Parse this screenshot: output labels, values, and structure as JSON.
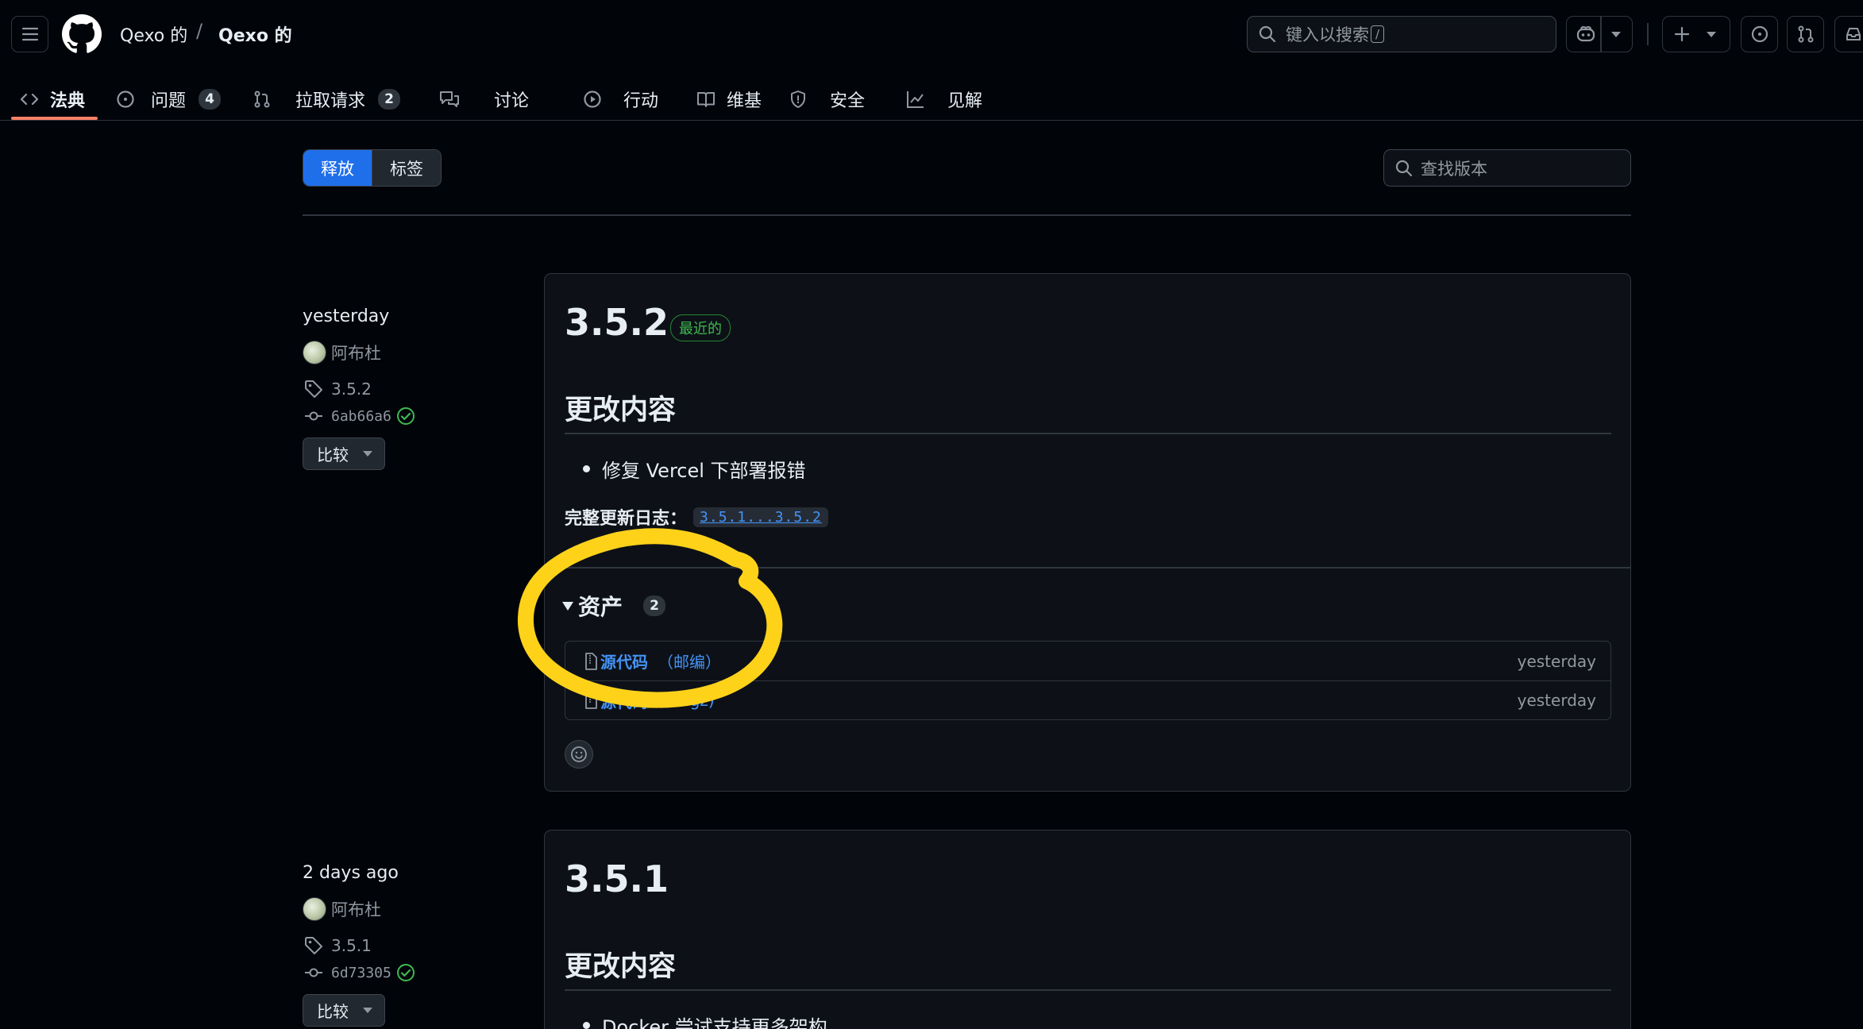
{
  "header": {
    "owner": "Qexo 的",
    "separator": "/",
    "repo": "Qexo 的",
    "search_placeholder": "键入以搜索",
    "search_shortcut": "/"
  },
  "repo_tabs": [
    {
      "label": "法典",
      "icon": "code-icon",
      "selected": true
    },
    {
      "label": "问题",
      "icon": "issue-icon",
      "count": "4"
    },
    {
      "label": "拉取请求",
      "icon": "pull-request-icon",
      "count": "2"
    },
    {
      "label": "讨论",
      "icon": "discussion-icon"
    },
    {
      "label": "行动",
      "icon": "play-icon"
    },
    {
      "label": "维基",
      "icon": "book-icon"
    },
    {
      "label": "安全",
      "icon": "shield-icon"
    },
    {
      "label": "见解",
      "icon": "graph-icon"
    }
  ],
  "subnav": {
    "releases_label": "释放",
    "tags_label": "标签",
    "filter_placeholder": "查找版本"
  },
  "releases": [
    {
      "date": "yesterday",
      "author": "阿布杜",
      "tag": "3.5.2",
      "commit": "6ab66a6",
      "compare_label": "比较",
      "title": "3.5.2",
      "latest_label": "最近的",
      "section_heading": "更改内容",
      "changes": [
        "修复 Vercel 下部署报错"
      ],
      "full_changelog_label": "完整更新日志：",
      "full_changelog_link": "3.5.1...3.5.2",
      "assets_label": "资产",
      "assets_count": "2",
      "assets": [
        {
          "name": "源代码",
          "kind": "（邮编）",
          "time": "yesterday"
        },
        {
          "name": "源代码",
          "kind": "(tar.gz)",
          "time": "yesterday"
        }
      ]
    },
    {
      "date": "2 days ago",
      "author": "阿布杜",
      "tag": "3.5.1",
      "commit": "6d73305",
      "compare_label": "比较",
      "title": "3.5.1",
      "section_heading": "更改内容",
      "changes": [
        "Docker 尝试支持更多架构"
      ]
    }
  ],
  "colors": {
    "accent": "#1f6feb",
    "link": "#4493f8",
    "success": "#3fb950",
    "tab_underline": "#f78166",
    "highlight_marker": "#ffd21a"
  }
}
